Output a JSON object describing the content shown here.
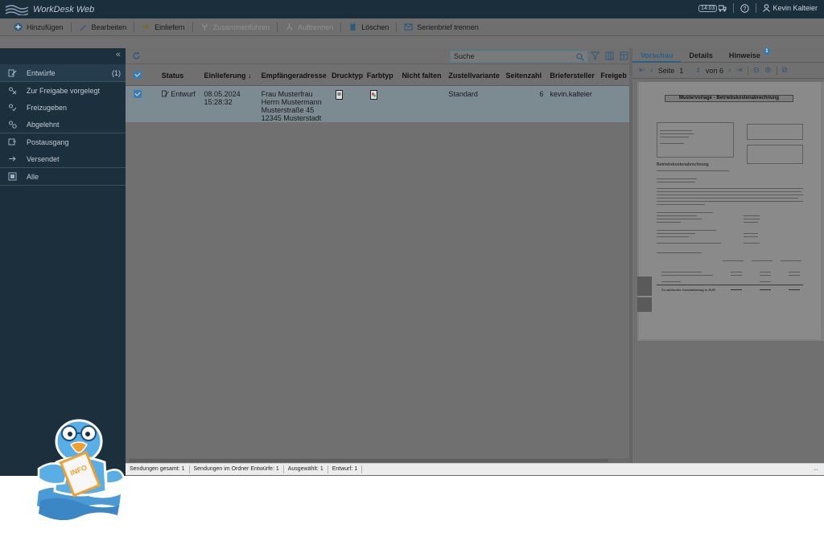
{
  "app": {
    "name": "WorkDesk Web",
    "queue_indicator": "14:03"
  },
  "header": {
    "help_icon": "question-icon",
    "user_name": "Kevin Kalteier"
  },
  "toolbar": {
    "add": "Hinzufügen",
    "edit": "Bearbeiten",
    "submit": "Einliefern",
    "merge": "Zusammenführen",
    "split": "Auftrennen",
    "delete": "Löschen",
    "serial_split": "Serienbrief trennen"
  },
  "sidebar": {
    "collapse": "«",
    "items": [
      {
        "label": "Entwürfe",
        "count": "(1)",
        "icon": "drafts-icon"
      },
      {
        "label": "Zur Freigabe vorgelegt",
        "icon": "approval-pending-icon"
      },
      {
        "label": "Freizugeben",
        "icon": "approve-icon"
      },
      {
        "label": "Abgelehnt",
        "icon": "rejected-icon"
      },
      {
        "label": "Postausgang",
        "icon": "outbox-icon"
      },
      {
        "label": "Versendet",
        "icon": "sent-icon"
      },
      {
        "label": "Alle",
        "icon": "all-icon"
      }
    ]
  },
  "search": {
    "placeholder": "Suche"
  },
  "table": {
    "columns": [
      "Status",
      "Einlieferung ↓",
      "Empfängeradresse",
      "Drucktyp",
      "Farbtyp",
      "Nicht falten",
      "Zustellvariante",
      "Seitenzahl",
      "Briefersteller",
      "Freigeb"
    ],
    "rows": [
      {
        "status": "Entwurf",
        "date": "08.05.2024",
        "time": "15:28:32",
        "address": [
          "Frau Musterfrau",
          "Herrn Mustermann",
          "Musterstraße 45",
          "12345 Musterstadt"
        ],
        "variant": "Standard",
        "pages": "6",
        "author": "kevin.kalteier"
      }
    ]
  },
  "preview": {
    "tabs": [
      "Vorschau",
      "Details",
      "Hinweise"
    ],
    "hint_count": "1",
    "page_label": "Seite",
    "page": "1",
    "of_label": "von 6",
    "doc_title": "Mustervorlage - Betriebskostenabrechnung",
    "doc_heading": "Betriebskostenabrechnung",
    "doc_total_label": "Zu zahlender Gesamtbetrag in EUR"
  },
  "statusbar": {
    "total": "Sendungen gesamt: 1",
    "in_folder": "Sendungen im Ordner Entwürfe: 1",
    "selected": "Ausgewählt: 1",
    "draft": "Entwurf: 1",
    "arrow": "⇔"
  },
  "mascot": {
    "badge": "INFO"
  },
  "colors": {
    "titlebar": "#1b2e3c",
    "sidebar": "#1c2f3d",
    "accent": "#2a5f86",
    "overlay": "#6b6b6b"
  }
}
